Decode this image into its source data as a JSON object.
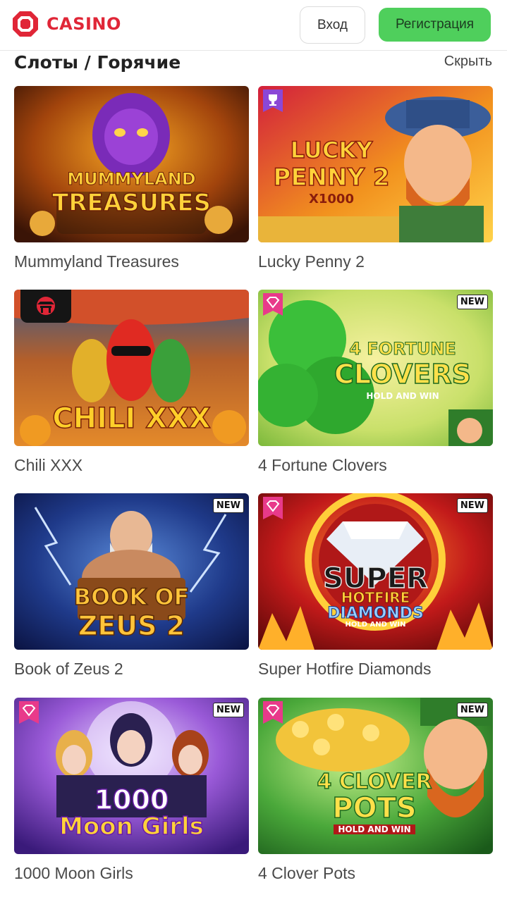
{
  "header": {
    "logo_text": "CASINO",
    "login_label": "Вход",
    "register_label": "Регистрация"
  },
  "section": {
    "title": "Слоты / Горячие",
    "hide_label": "Скрыть"
  },
  "games": [
    {
      "title": "Mummyland Treasures",
      "art_line1": "MUMMYLAND",
      "art_line2": "TREASURES",
      "badge_new": "",
      "corner_icon": ""
    },
    {
      "title": "Lucky Penny 2",
      "art_line1": "LUCKY",
      "art_line2": "PENNY 2",
      "art_line3": "X1000",
      "badge_new": "",
      "corner_icon": "trophy-icon"
    },
    {
      "title": "Chili XXX",
      "art_line1": "CHILI XXX",
      "badge_new": "",
      "corner_icon": "temple-icon"
    },
    {
      "title": "4 Fortune Clovers",
      "art_line1": "4 FORTUNE",
      "art_line2": "CLOVERS",
      "art_line3": "HOLD AND WIN",
      "badge_new": "NEW",
      "corner_icon": "diamond-icon"
    },
    {
      "title": "Book of Zeus 2",
      "art_line1": "BOOK OF",
      "art_line2": "ZEUS 2",
      "badge_new": "NEW",
      "corner_icon": ""
    },
    {
      "title": "Super Hotfire Diamonds",
      "art_line1": "SUPER",
      "art_line2": "HOTFIRE",
      "art_line3": "DIAMONDS",
      "art_line4": "HOLD AND WIN",
      "badge_new": "NEW",
      "corner_icon": "diamond-icon"
    },
    {
      "title": "1000 Moon Girls",
      "art_line1": "1000",
      "art_line2": "Moon Girls",
      "badge_new": "NEW",
      "corner_icon": "diamond-icon"
    },
    {
      "title": "4 Clover Pots",
      "art_line1": "4 CLOVER",
      "art_line2": "POTS",
      "art_line3": "HOLD AND WIN",
      "badge_new": "NEW",
      "corner_icon": "diamond-icon"
    }
  ],
  "colors": {
    "brand_red": "#e02637",
    "register_green": "#4fcf5c"
  }
}
